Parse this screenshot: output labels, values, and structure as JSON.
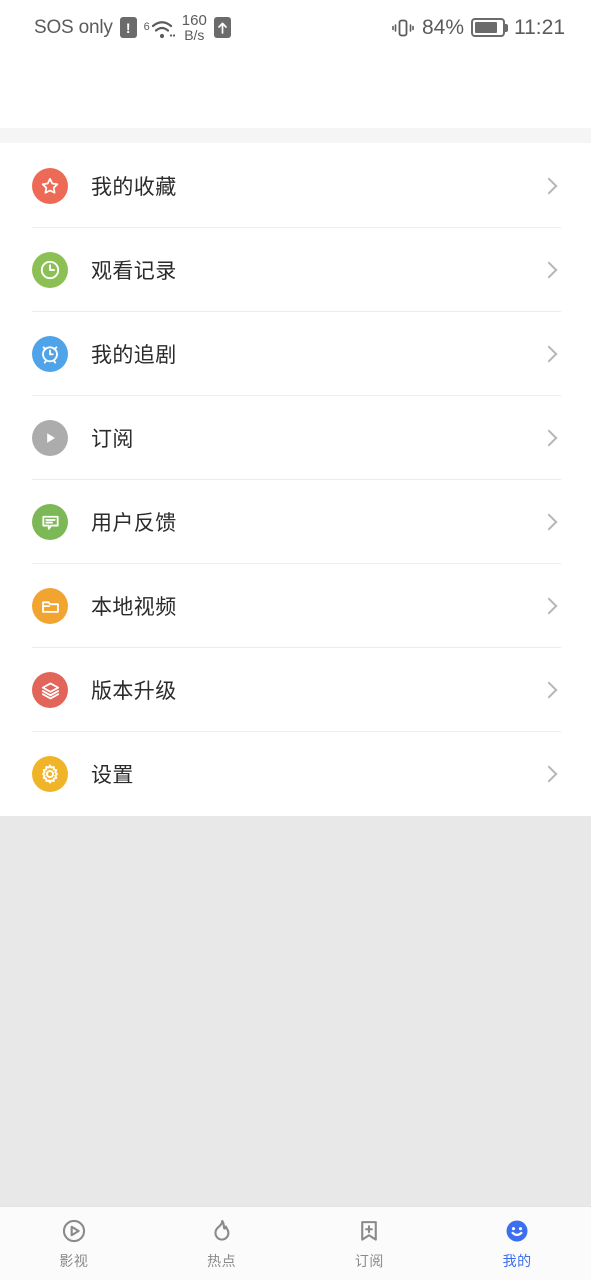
{
  "status_bar": {
    "carrier": "SOS only",
    "warning_glyph": "!",
    "wifi_standard": "6",
    "net_speed_value": "160",
    "net_speed_unit": "B/s",
    "battery_percent": "84%",
    "battery_level": 84,
    "time": "11:21",
    "icons": [
      "alert-icon",
      "wifi-icon",
      "upload-icon",
      "vibrate-icon",
      "battery-icon"
    ]
  },
  "colors": {
    "accent": "#3c6ef0",
    "favorite": "#ec6a56",
    "history": "#8cbf54",
    "follow": "#4fa3e8",
    "subscribe": "#acacac",
    "feedback": "#7cb856",
    "local_video": "#f2a431",
    "upgrade": "#e2655a",
    "settings": "#f0b429",
    "page_background": "#e8e8e8",
    "card_background": "#ffffff",
    "divider": "#ededed"
  },
  "menu": {
    "items": [
      {
        "label": "我的收藏",
        "icon": "star-icon",
        "color": "#ec6a56"
      },
      {
        "label": "观看记录",
        "icon": "clock-icon",
        "color": "#8cbf54"
      },
      {
        "label": "我的追剧",
        "icon": "alarm-clock-icon",
        "color": "#4fa3e8"
      },
      {
        "label": "订阅",
        "icon": "play-icon",
        "color": "#acacac"
      },
      {
        "label": "用户反馈",
        "icon": "chat-bubble-icon",
        "color": "#7cb856"
      },
      {
        "label": "本地视频",
        "icon": "folder-icon",
        "color": "#f2a431"
      },
      {
        "label": "版本升级",
        "icon": "layers-icon",
        "color": "#e2655a"
      },
      {
        "label": "设置",
        "icon": "gear-icon",
        "color": "#f0b429"
      }
    ]
  },
  "bottom_nav": {
    "items": [
      {
        "label": "影视",
        "icon": "play-circle-icon",
        "active": false
      },
      {
        "label": "热点",
        "icon": "flame-icon",
        "active": false
      },
      {
        "label": "订阅",
        "icon": "bookmark-plus-icon",
        "active": false
      },
      {
        "label": "我的",
        "icon": "smiley-face-icon",
        "active": true
      }
    ]
  }
}
